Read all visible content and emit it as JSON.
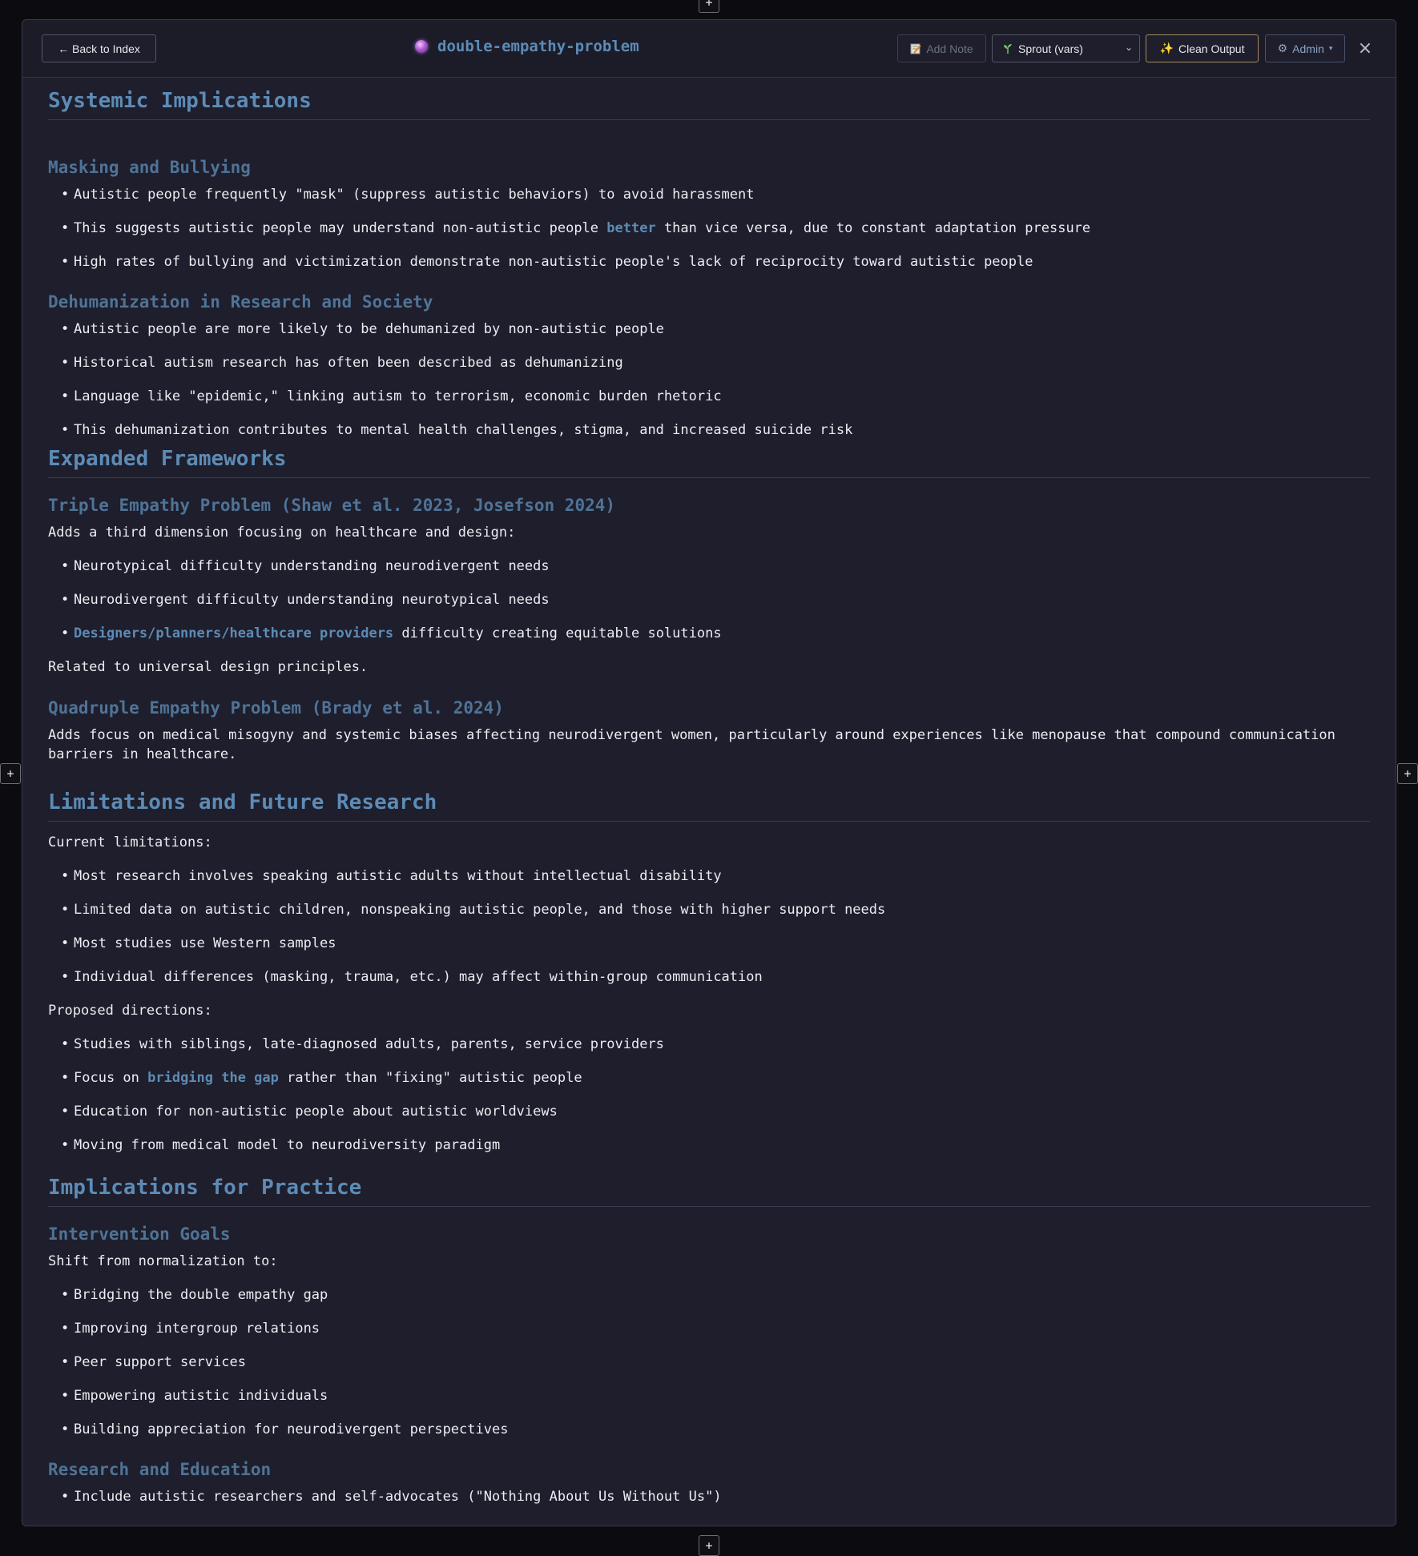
{
  "header": {
    "back_label": "← Back to Index",
    "title": "double-empathy-problem",
    "add_note_label": "Add Note",
    "sprout_label": "Sprout (vars)",
    "clean_label": "Clean Output",
    "admin_label": "Admin",
    "close_label": "×"
  },
  "edge_buttons": {
    "top": "+",
    "left": "+",
    "right": "+",
    "bottom": "+"
  },
  "content": {
    "s1": {
      "title": "Systemic Implications",
      "sub1": {
        "title": "Masking and Bullying",
        "b1": "Autistic people frequently \"mask\" (suppress autistic behaviors) to avoid harassment",
        "b2_pre": "This suggests autistic people may understand non-autistic people ",
        "b2_link": "better",
        "b2_post": " than vice versa, due to constant adaptation pressure",
        "b3": "High rates of bullying and victimization demonstrate non-autistic people's lack of reciprocity toward autistic people"
      },
      "sub2": {
        "title": "Dehumanization in Research and Society",
        "b1": "Autistic people are more likely to be dehumanized by non-autistic people",
        "b2": "Historical autism research has often been described as dehumanizing",
        "b3": "Language like \"epidemic,\" linking autism to terrorism, economic burden rhetoric",
        "b4": "This dehumanization contributes to mental health challenges, stigma, and increased suicide risk"
      }
    },
    "s2": {
      "title": "Expanded Frameworks",
      "sub1": {
        "title": "Triple Empathy Problem (Shaw et al. 2023, Josefson 2024)",
        "intro": "Adds a third dimension focusing on healthcare and design:",
        "b1": "Neurotypical difficulty understanding neurodivergent needs",
        "b2": "Neurodivergent difficulty understanding neurotypical needs",
        "b3_link": "Designers/planners/healthcare providers",
        "b3_post": " difficulty creating equitable solutions",
        "outro": "Related to universal design principles."
      },
      "sub2": {
        "title": "Quadruple Empathy Problem (Brady et al. 2024)",
        "text": "Adds focus on medical misogyny and systemic biases affecting neurodivergent women, particularly around experiences like menopause that compound communication barriers in healthcare."
      }
    },
    "s3": {
      "title": "Limitations and Future Research",
      "intro1": "Current limitations:",
      "l1": "Most research involves speaking autistic adults without intellectual disability",
      "l2": "Limited data on autistic children, nonspeaking autistic people, and those with higher support needs",
      "l3": "Most studies use Western samples",
      "l4": "Individual differences (masking, trauma, etc.) may affect within-group communication",
      "intro2": "Proposed directions:",
      "d1": "Studies with siblings, late-diagnosed adults, parents, service providers",
      "d2_pre": "Focus on ",
      "d2_link": "bridging the gap",
      "d2_post": " rather than \"fixing\" autistic people",
      "d3": "Education for non-autistic people about autistic worldviews",
      "d4": "Moving from medical model to neurodiversity paradigm"
    },
    "s4": {
      "title": "Implications for Practice",
      "sub1": {
        "title": "Intervention Goals",
        "intro": "Shift from normalization to:",
        "b1": "Bridging the double empathy gap",
        "b2": "Improving intergroup relations",
        "b3": "Peer support services",
        "b4": "Empowering autistic individuals",
        "b5": "Building appreciation for neurodivergent perspectives"
      },
      "sub2": {
        "title": "Research and Education",
        "b1": "Include autistic researchers and self-advocates (\"Nothing About Us Without Us\")"
      }
    }
  }
}
